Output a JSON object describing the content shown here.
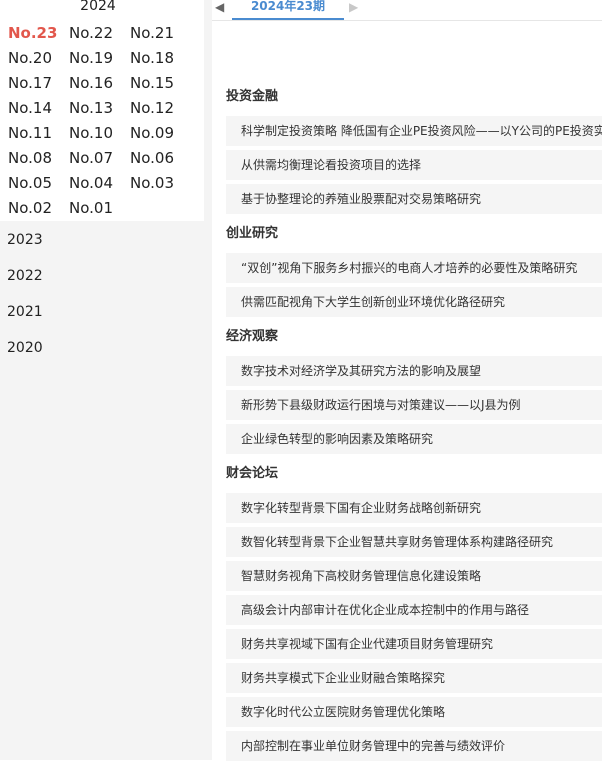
{
  "sidebar": {
    "current_year": "2024",
    "issues": [
      {
        "label": "No.23",
        "active": true
      },
      {
        "label": "No.22"
      },
      {
        "label": "No.21"
      },
      {
        "label": "No.20"
      },
      {
        "label": "No.19"
      },
      {
        "label": "No.18"
      },
      {
        "label": "No.17"
      },
      {
        "label": "No.16"
      },
      {
        "label": "No.15"
      },
      {
        "label": "No.14"
      },
      {
        "label": "No.13"
      },
      {
        "label": "No.12"
      },
      {
        "label": "No.11"
      },
      {
        "label": "No.10"
      },
      {
        "label": "No.09"
      },
      {
        "label": "No.08"
      },
      {
        "label": "No.07"
      },
      {
        "label": "No.06"
      },
      {
        "label": "No.05"
      },
      {
        "label": "No.04"
      },
      {
        "label": "No.03"
      },
      {
        "label": "No.02"
      },
      {
        "label": "No.01"
      }
    ],
    "other_years": [
      "2023",
      "2022",
      "2021",
      "2020"
    ]
  },
  "tabbar": {
    "current_tab": "2024年23期",
    "prev_icon": "◀",
    "next_icon": "▶"
  },
  "sections": [
    {
      "title": "投资金融",
      "articles": [
        "科学制定投资策略 降低国有企业PE投资风险——以Y公司的PE投资实",
        "从供需均衡理论看投资项目的选择",
        "基于协整理论的养殖业股票配对交易策略研究"
      ]
    },
    {
      "title": "创业研究",
      "articles": [
        "“双创”视角下服务乡村振兴的电商人才培养的必要性及策略研究",
        "供需匹配视角下大学生创新创业环境优化路径研究"
      ]
    },
    {
      "title": "经济观察",
      "articles": [
        "数字技术对经济学及其研究方法的影响及展望",
        "新形势下县级财政运行困境与对策建议——以J县为例",
        "企业绿色转型的影响因素及策略研究"
      ]
    },
    {
      "title": "财会论坛",
      "articles": [
        "数字化转型背景下国有企业财务战略创新研究",
        "数智化转型背景下企业智慧共享财务管理体系构建路径研究",
        "智慧财务视角下高校财务管理信息化建设策略",
        "高级会计内部审计在优化企业成本控制中的作用与路径",
        "财务共享视域下国有企业代建项目财务管理研究",
        "财务共享模式下企业业财融合策略探究",
        "数字化时代公立医院财务管理优化策略",
        "内部控制在事业单位财务管理中的完善与绩效评价"
      ]
    }
  ],
  "colors": {
    "active_issue": "#e2574c",
    "tab_accent": "#4a8bd0"
  }
}
